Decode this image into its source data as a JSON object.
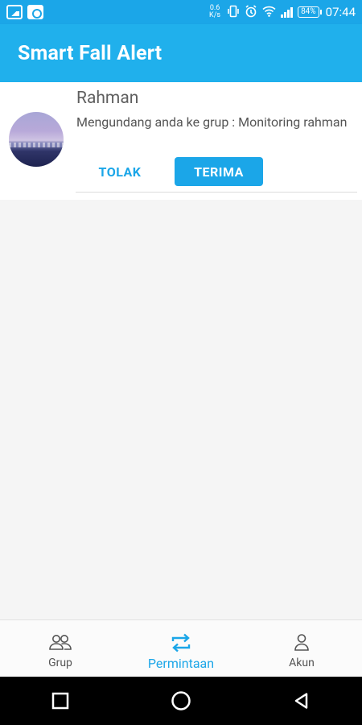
{
  "status_bar": {
    "net_speed_value": "0.6",
    "net_speed_unit": "K/s",
    "battery": "84%",
    "time": "07:44",
    "icons": [
      "image-icon",
      "app-notification-icon",
      "vibrate-icon",
      "alarm-icon",
      "wifi-icon",
      "signal-icon",
      "battery-icon"
    ]
  },
  "app_bar": {
    "title": "Smart Fall Alert"
  },
  "request": {
    "sender_name": "Rahman",
    "message": "Mengundang anda ke grup : Monitoring rahman",
    "reject_label": "TOLAK",
    "accept_label": "TERIMA"
  },
  "bottom_nav": {
    "items": [
      {
        "label": "Grup",
        "icon": "group-icon",
        "active": false
      },
      {
        "label": "Permintaan",
        "icon": "swap-icon",
        "active": true
      },
      {
        "label": "Akun",
        "icon": "account-icon",
        "active": false
      }
    ]
  },
  "system_nav": {
    "icons": [
      "recents-icon",
      "home-icon",
      "back-icon"
    ]
  },
  "colors": {
    "accent": "#1ba6e8",
    "app_bar": "#20b0ec",
    "background": "#f5f5f5"
  }
}
